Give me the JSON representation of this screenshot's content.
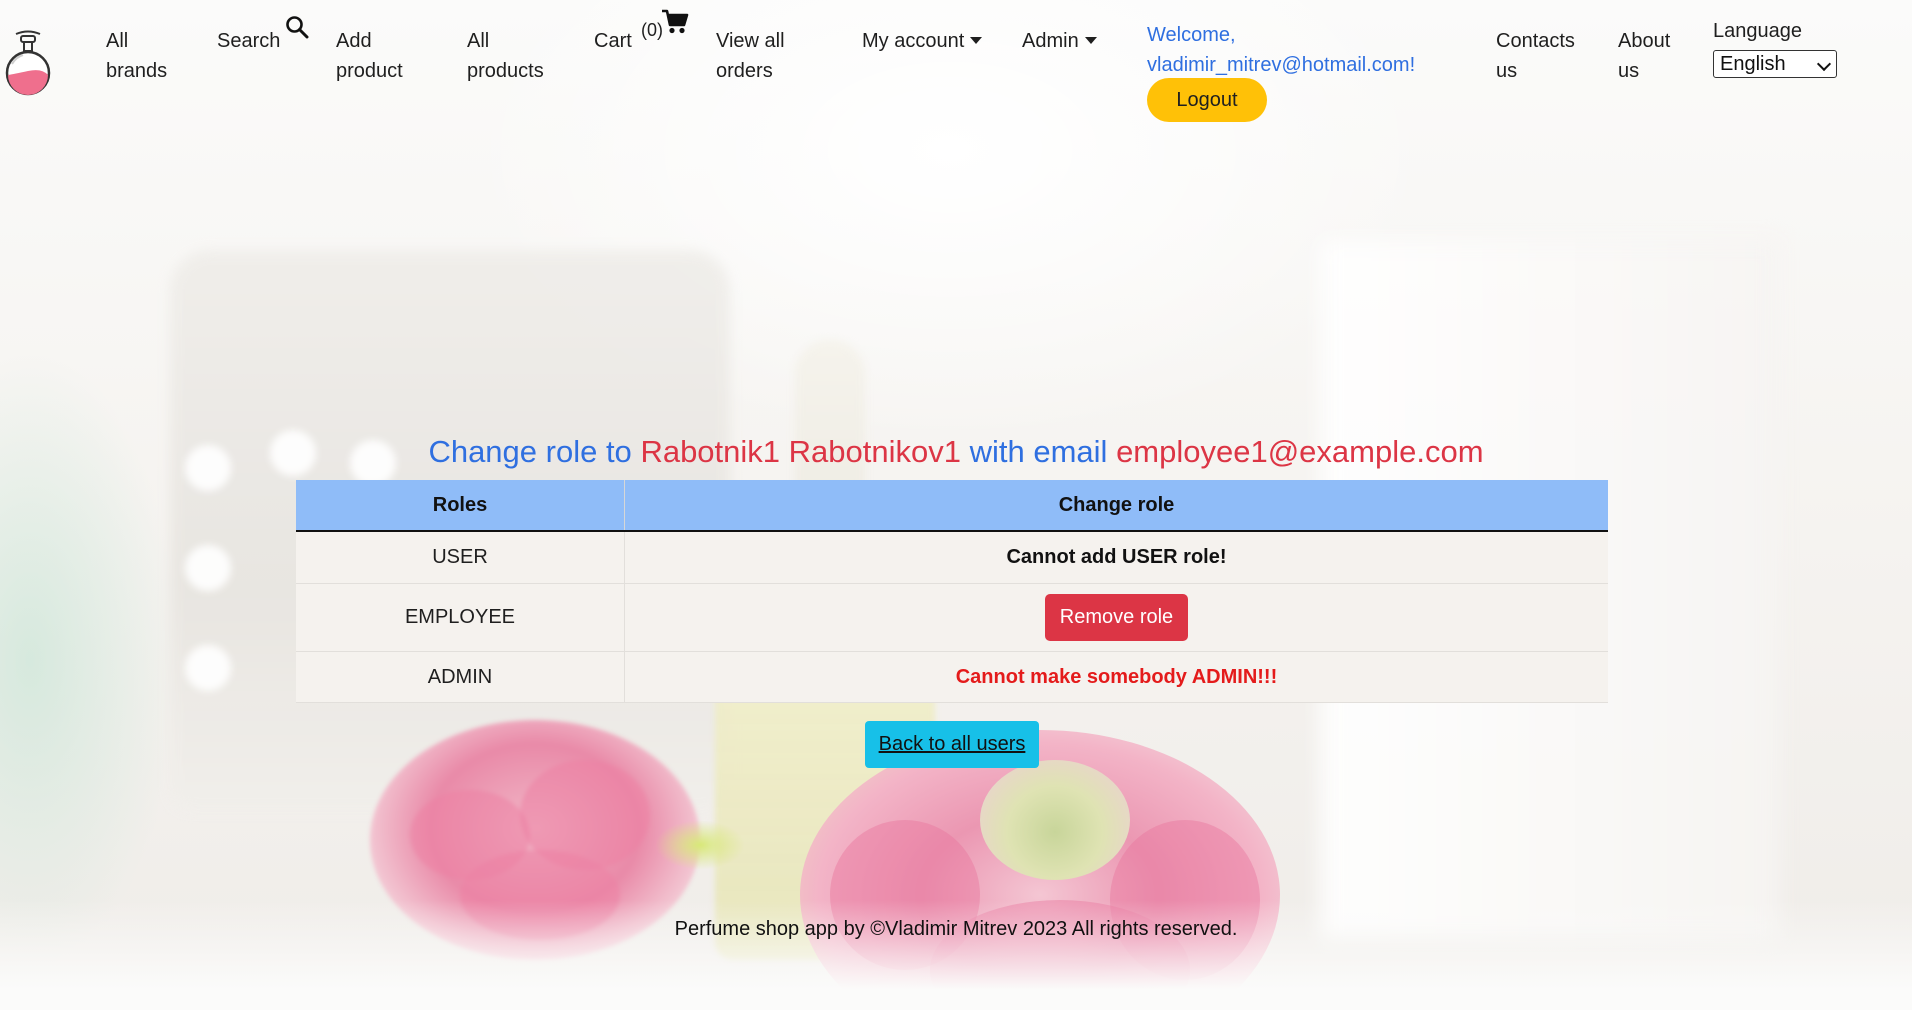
{
  "nav": {
    "all_brands": [
      "All",
      "brands"
    ],
    "search": "Search",
    "add_product": [
      "Add",
      "product"
    ],
    "all_products": [
      "All",
      "products"
    ],
    "cart": "Cart",
    "cart_count": "(0)",
    "view_all_orders": [
      "View all",
      "orders"
    ],
    "my_account": "My account",
    "admin": "Admin",
    "welcome": [
      "Welcome,",
      "vladimir_mitrev@hotmail.com!"
    ],
    "logout": "Logout",
    "contacts_us": [
      "Contacts",
      "us"
    ],
    "about_us": [
      "About",
      "us"
    ],
    "language_label": "Language",
    "language_selected": "English"
  },
  "title": {
    "prefix": "Change role to",
    "name": "Rabotnik1 Rabotnikov1",
    "middle": "with email",
    "email": "employee1@example.com"
  },
  "table": {
    "headers": [
      "Roles",
      "Change role"
    ],
    "rows": [
      {
        "role": "USER",
        "action": "Cannot add USER role!"
      },
      {
        "role": "EMPLOYEE",
        "action": "Remove role"
      },
      {
        "role": "ADMIN",
        "action": "Cannot make somebody ADMIN!!!"
      }
    ]
  },
  "back_button": "Back to all users",
  "footer": "Perfume shop app by ©Vladimir Mitrev 2023 All rights reserved.",
  "colors": {
    "accent_blue": "#2f6fe0",
    "danger_red": "#dc3545",
    "warning_yellow": "#ffc107",
    "info_cyan": "#17c0e8",
    "table_header": "#8fbcf8"
  },
  "icons": {
    "logo": "perfume-bottle-icon",
    "search": "search-icon",
    "cart": "cart-icon"
  }
}
